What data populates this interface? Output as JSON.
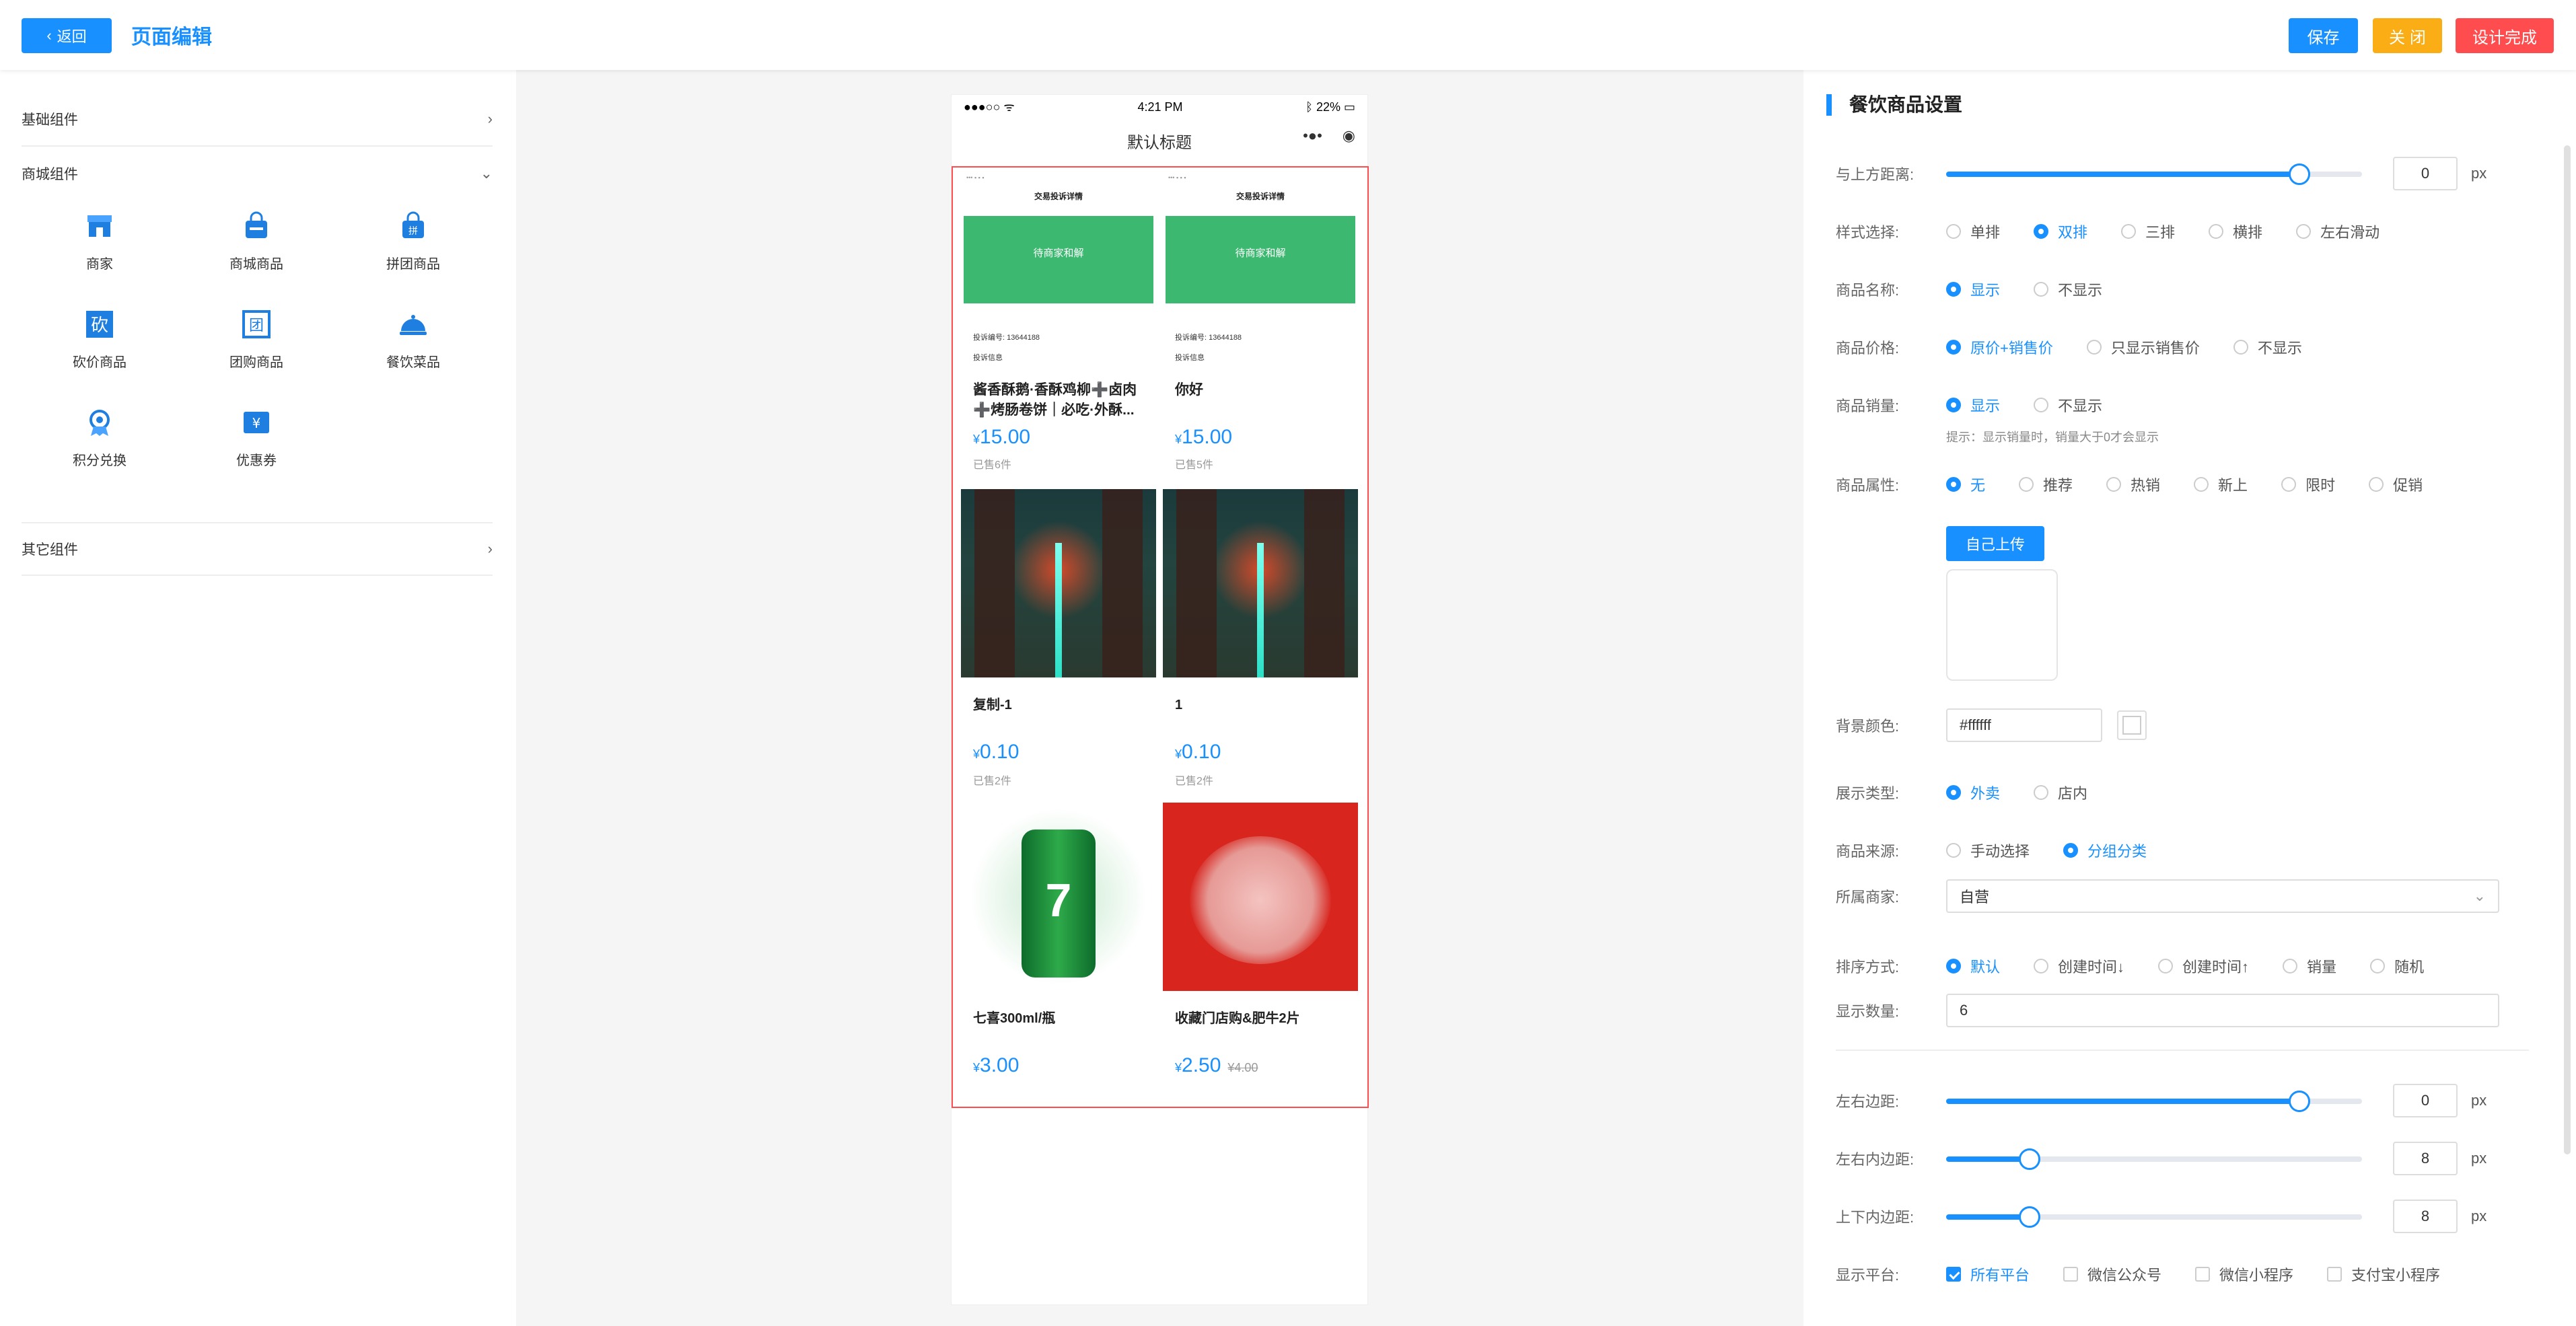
{
  "header": {
    "back_label": "返回",
    "title": "页面编辑",
    "save": "保存",
    "close": "关 闭",
    "done": "设计完成",
    "colors": {
      "primary": "#1890ff",
      "warning": "#faad14",
      "danger": "#ff4d4f"
    }
  },
  "left": {
    "basic_group": "基础组件",
    "mall_group": "商城组件",
    "other_group": "其它组件",
    "components": [
      {
        "label": "商家",
        "icon": "shop-icon"
      },
      {
        "label": "商城商品",
        "icon": "bag-icon"
      },
      {
        "label": "拼团商品",
        "icon": "group-buy-icon"
      },
      {
        "label": "砍价商品",
        "icon": "bargain-icon"
      },
      {
        "label": "团购商品",
        "icon": "team-buy-icon"
      },
      {
        "label": "餐饮菜品",
        "icon": "dish-icon"
      },
      {
        "label": "积分兑换",
        "icon": "points-icon"
      },
      {
        "label": "优惠券",
        "icon": "coupon-icon"
      }
    ]
  },
  "phone": {
    "time": "4:21 PM",
    "battery": "22%",
    "title": "默认标题",
    "currency": "¥",
    "products": [
      {
        "name": "酱香酥鹅·香酥鸡柳➕卤肉➕烤肠卷饼｜必吃·外酥...",
        "price": "15.00",
        "sold": "已售6件",
        "thumb_title": "交易投诉详情",
        "thumb_status": "待商家和解",
        "thumb_no": "投诉编号: 13644188",
        "thumb_info": "投诉信息"
      },
      {
        "name": "你好",
        "price": "15.00",
        "sold": "已售5件",
        "thumb_title": "交易投诉详情",
        "thumb_status": "待商家和解",
        "thumb_no": "投诉编号: 13644188",
        "thumb_info": "投诉信息"
      },
      {
        "name": "复制-1",
        "price": "0.10",
        "sold": "已售2件"
      },
      {
        "name": "1",
        "price": "0.10",
        "sold": "已售2件"
      },
      {
        "name": "七喜300ml/瓶",
        "price": "3.00"
      },
      {
        "name": "收藏门店购&肥牛2片",
        "price": "2.50",
        "orig": "¥4.00"
      }
    ]
  },
  "settings": {
    "section_title": "餐饮商品设置",
    "top_margin": {
      "label": "与上方距离:",
      "value": "0",
      "unit": "px",
      "fraction": 0.85
    },
    "style": {
      "label": "样式选择:",
      "options": [
        "单排",
        "双排",
        "三排",
        "横排",
        "左右滑动"
      ],
      "selected": 1
    },
    "name_show": {
      "label": "商品名称:",
      "options": [
        "显示",
        "不显示"
      ],
      "selected": 0
    },
    "price_show": {
      "label": "商品价格:",
      "options": [
        "原价+销售价",
        "只显示销售价",
        "不显示"
      ],
      "selected": 0
    },
    "sales_show": {
      "label": "商品销量:",
      "options": [
        "显示",
        "不显示"
      ],
      "selected": 0,
      "hint": "提示：显示销量时，销量大于0才会显示"
    },
    "attr": {
      "label": "商品属性:",
      "options": [
        "无",
        "推荐",
        "热销",
        "新上",
        "限时",
        "促销"
      ],
      "selected": 0
    },
    "upload_label": "自己上传",
    "bg_color": {
      "label": "背景颜色:",
      "value": "#ffffff"
    },
    "display_type": {
      "label": "展示类型:",
      "options": [
        "外卖",
        "店内"
      ],
      "selected": 0
    },
    "source": {
      "label": "商品来源:",
      "options": [
        "手动选择",
        "分组分类"
      ],
      "selected": 1
    },
    "merchant": {
      "label": "所属商家:",
      "value": "自营"
    },
    "sort": {
      "label": "排序方式:",
      "options": [
        "默认",
        "创建时间↓",
        "创建时间↑",
        "销量",
        "随机"
      ],
      "selected": 0
    },
    "count": {
      "label": "显示数量:",
      "value": "6"
    },
    "lr_margin": {
      "label": "左右边距:",
      "value": "0",
      "unit": "px",
      "fraction": 0.85
    },
    "lr_padding": {
      "label": "左右内边距:",
      "value": "8",
      "unit": "px",
      "fraction": 0.2
    },
    "tb_padding": {
      "label": "上下内边距:",
      "value": "8",
      "unit": "px",
      "fraction": 0.2
    },
    "platform": {
      "label": "显示平台:",
      "options": [
        "所有平台",
        "微信公众号",
        "微信小程序",
        "支付宝小程序"
      ],
      "checked": [
        0
      ]
    }
  }
}
